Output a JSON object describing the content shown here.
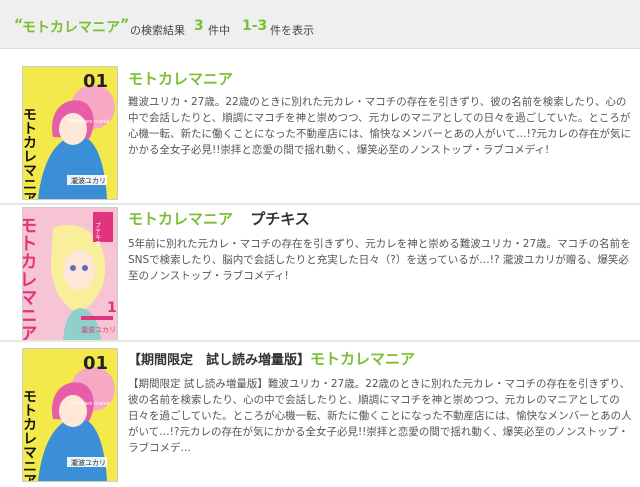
{
  "summary": {
    "query_open": "“",
    "query": "モトカレマニア",
    "query_close": "”",
    "results_label": "の検索結果",
    "count": "3",
    "count_suffix": "件中",
    "range": "1-3",
    "range_suffix": "件を表示"
  },
  "items": [
    {
      "title": "モトカレマニア",
      "label": "",
      "desc": [
        "難波ユリカ・27歳。22歳のときに別れた元カレ・マコチの存在を引きずり、彼の名前を検索したり、心の",
        "中で会話したりと、順調にマコチを神と崇めつつ、元カレのマニアとしての日々を過ごしていた。ところが",
        "心機一転、新たに働くことになった不動産店には、愉快なメンバーとあの人がいて…!?元カレの存在が気に",
        "かかる全女子必見!!崇拝と恋愛の間で揺れ動く、爆笑必至のノンストップ・ラブコメディ!"
      ],
      "cover": {
        "volume": "01",
        "title_text": "モトカレマニア",
        "sub": "Motokare mania",
        "author": "瀧波ユカリ",
        "bg": "#f4e94a"
      }
    },
    {
      "title": "モトカレマニア",
      "label": "プチキス",
      "desc": [
        "5年前に別れた元カレ・マコチの存在を引きずり、元カレを神と崇める難波ユリカ・27歳。マコチの名前を",
        "SNSで検索したり、脳内で会話したりと充実した日々（?）を送っているが…!? 瀧波ユカリが贈る、爆笑必",
        "至のノンストップ・ラブコメディ!"
      ],
      "cover": {
        "volume": "1",
        "title_text": "モトカレマニア",
        "badge": "プチキス",
        "author": "瀧波ユカリ",
        "bg": "#f7c4d4"
      }
    },
    {
      "title_prefix": "【期間限定　試し読み増量版】",
      "title": "モトカレマニア",
      "desc": [
        "【期間限定 試し読み増量版】難波ユリカ・27歳。22歳のときに別れた元カレ・マコチの存在を引きずり、",
        "彼の名前を検索したり、心の中で会話したりと、順調にマコチを神と崇めつつ、元カレのマニアとしての",
        "日々を過ごしていた。ところが心機一転、新たに働くことになった不動産店には、愉快なメンバーとあの人",
        "がいて…!?元カレの存在が気にかかる全女子必見!!崇拝と恋愛の間で揺れ動く、爆笑必至のノンストップ・",
        "ラブコメデ…"
      ],
      "cover": {
        "volume": "01",
        "title_text": "モトカレマニア",
        "sub": "Motokare mania",
        "author": "瀧波ユカリ",
        "bg": "#f4e94a"
      }
    }
  ],
  "colors": {
    "accent": "#7cc031",
    "topbar": "#efefef"
  }
}
